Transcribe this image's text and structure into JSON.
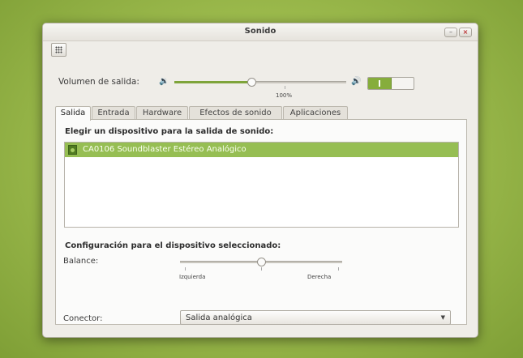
{
  "window": {
    "title": "Sonido"
  },
  "titlebar_buttons": {
    "minimize": "–",
    "close": "×"
  },
  "volume": {
    "label": "Volumen de salida:",
    "level_percent": 45,
    "tick_label": "100%",
    "enabled": true
  },
  "tabs": [
    {
      "label": "Salida",
      "active": true
    },
    {
      "label": "Entrada",
      "active": false
    },
    {
      "label": "Hardware",
      "active": false
    },
    {
      "label": "Efectos de sonido",
      "active": false
    },
    {
      "label": "Aplicaciones",
      "active": false
    }
  ],
  "output": {
    "choose_device_title": "Elegir un dispositivo para la salida de sonido:",
    "devices": [
      {
        "name": "CA0106 Soundblaster Estéreo Analógico",
        "selected": true
      }
    ],
    "config_title": "Configuración para el dispositivo seleccionado:",
    "balance": {
      "label": "Balance:",
      "left_label": "Izquierda",
      "right_label": "Derecha",
      "value": 0.5
    },
    "connector": {
      "label": "Conector:",
      "value": "Salida analógica"
    }
  },
  "icons": {
    "apps": "grid-icon",
    "speaker_low": "speaker-low-icon",
    "speaker_high": "speaker-high-icon",
    "device": "sound-card-icon",
    "dropdown": "chevron-down-icon"
  },
  "colors": {
    "accent": "#86ad3c",
    "selection": "#96be53",
    "desktop": "#9fbd4f"
  }
}
